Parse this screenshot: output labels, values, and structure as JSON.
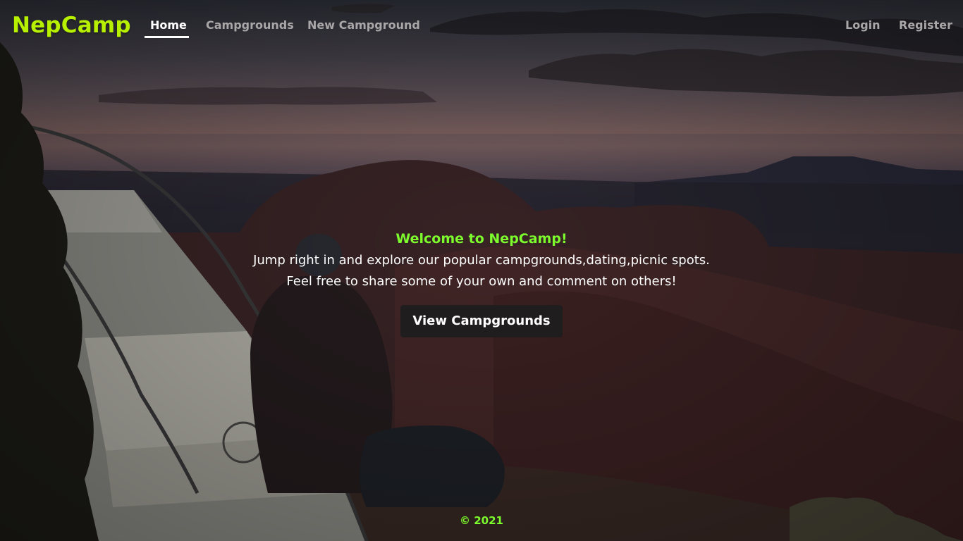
{
  "brand": {
    "name": "NepCamp",
    "color": "#b7f000"
  },
  "nav": {
    "left": [
      {
        "label": "Home",
        "active": true
      },
      {
        "label": "Campgrounds",
        "active": false
      },
      {
        "label": "New Campground",
        "active": false
      }
    ],
    "right": [
      {
        "label": "Login"
      },
      {
        "label": "Register"
      }
    ]
  },
  "hero": {
    "welcome": "Welcome to NepCamp!",
    "lead_line1": "Jump right in and explore our popular campgrounds,dating,picnic spots.",
    "lead_line2": "Feel free to share some of your own and comment on others!",
    "cta_label": "View Campgrounds",
    "accent_color": "#7dfc2d"
  },
  "footer": {
    "text": "© 2021"
  }
}
